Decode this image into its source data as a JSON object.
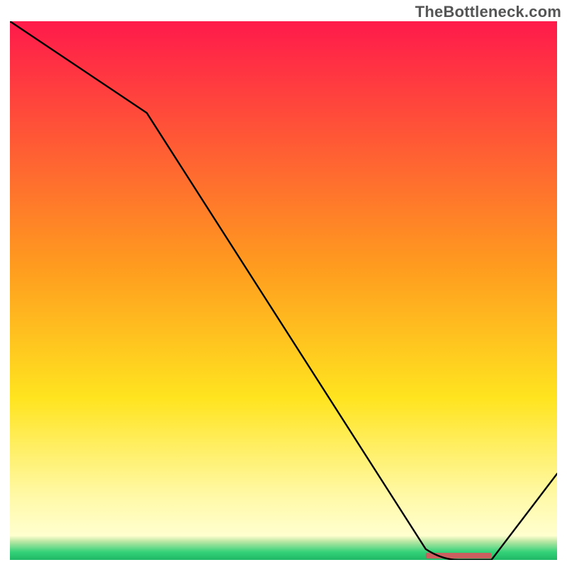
{
  "watermark": "TheBottleneck.com",
  "chart_data": {
    "type": "line",
    "title": "",
    "xlabel": "",
    "ylabel": "",
    "xlim": [
      0,
      100
    ],
    "ylim": [
      0,
      100
    ],
    "x": [
      0,
      25,
      76,
      82,
      88,
      100
    ],
    "values": [
      100,
      83,
      2,
      0,
      0,
      16
    ],
    "marker": {
      "x_start": 76,
      "x_end": 88,
      "y": 0,
      "color": "#cb5f5f"
    },
    "gradient_stops": [
      {
        "offset": 0.0,
        "color": "#ff1a4b"
      },
      {
        "offset": 0.45,
        "color": "#ff9a1f"
      },
      {
        "offset": 0.7,
        "color": "#ffe41f"
      },
      {
        "offset": 0.88,
        "color": "#fff9a6"
      },
      {
        "offset": 0.955,
        "color": "#ffffcf"
      },
      {
        "offset": 0.965,
        "color": "#bfe8a6"
      },
      {
        "offset": 0.985,
        "color": "#36d27a"
      },
      {
        "offset": 1.0,
        "color": "#1fb865"
      }
    ],
    "legend": null,
    "grid": false
  }
}
